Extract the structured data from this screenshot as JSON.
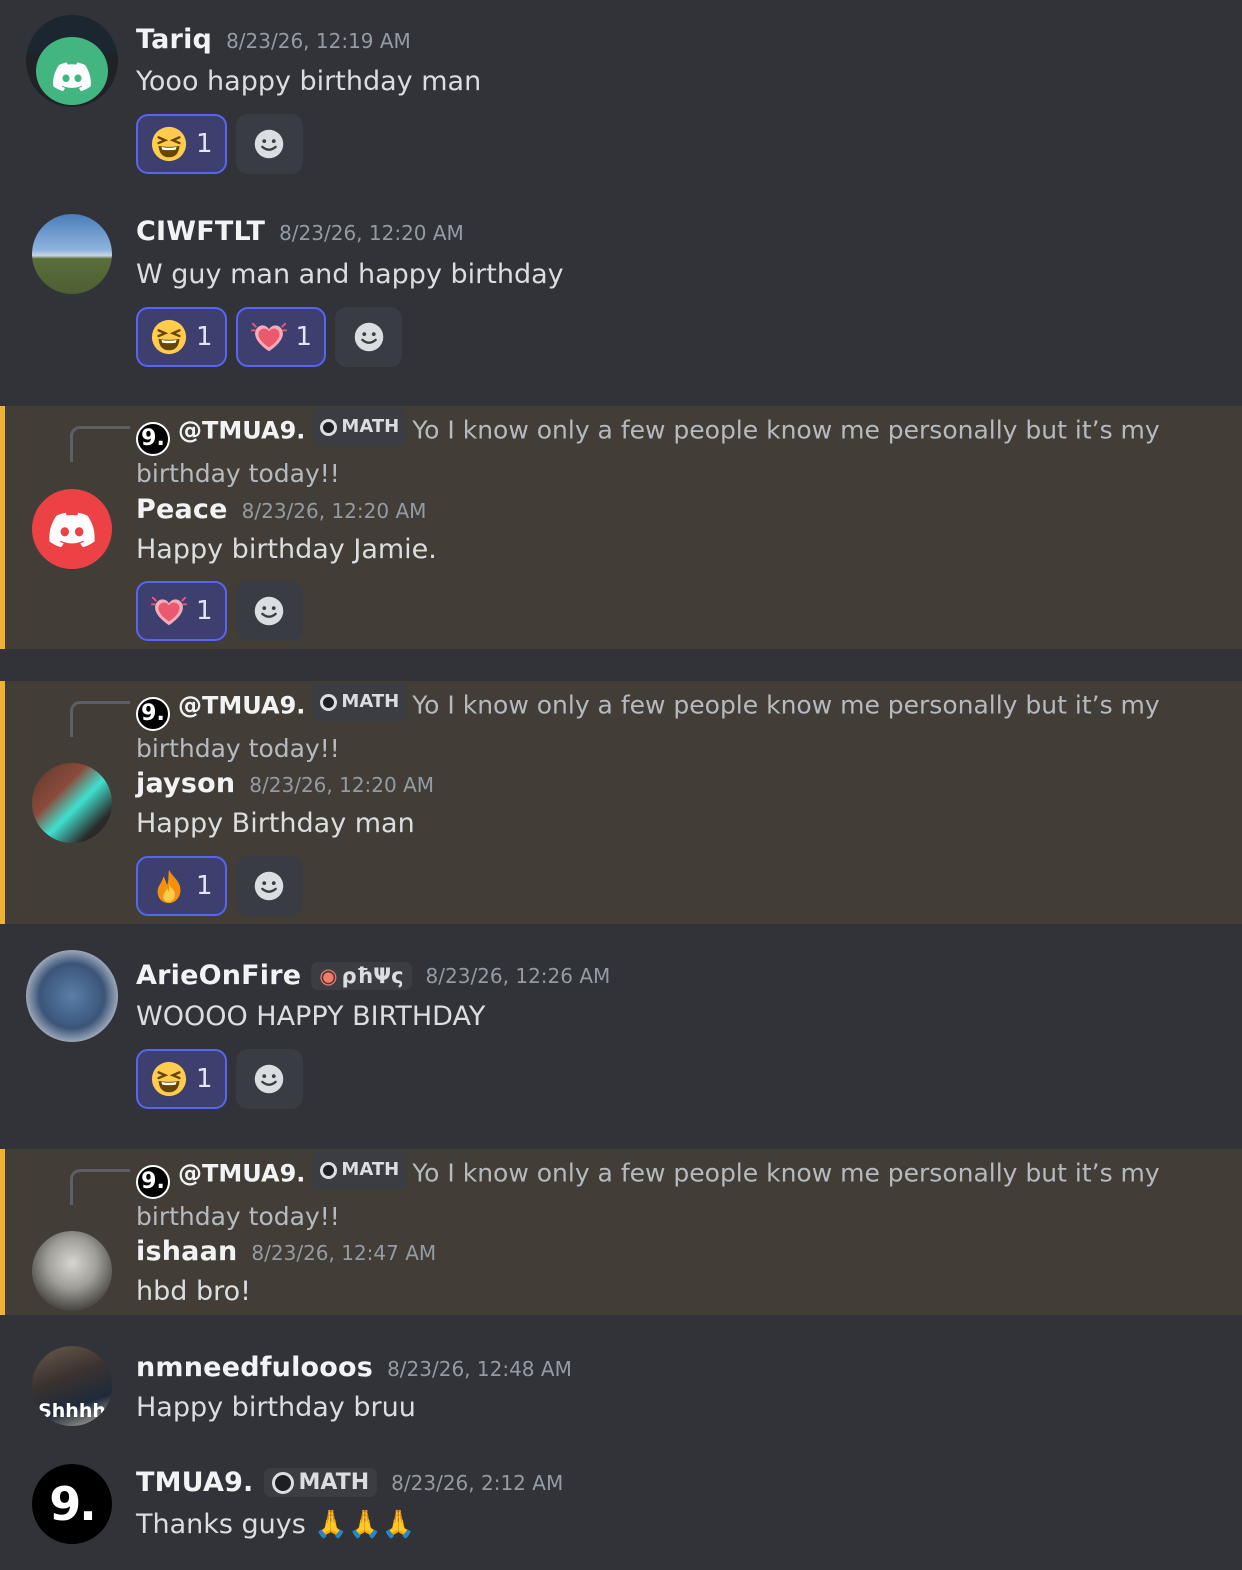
{
  "messages": [
    {
      "username": "Tariq",
      "timestamp": "8/23/26, 12:19 AM",
      "text": "Yooo happy birthday man",
      "reactions": [
        {
          "emoji": "laughing",
          "count": "1"
        }
      ]
    },
    {
      "username": "CIWFTLT",
      "timestamp": "8/23/26, 12:20 AM",
      "text": "W guy man and happy birthday",
      "reactions": [
        {
          "emoji": "laughing",
          "count": "1"
        },
        {
          "emoji": "heartpulse",
          "count": "1"
        }
      ]
    },
    {
      "reply": {
        "avatar_text": "9.",
        "mention": "@TMUA9.",
        "tag": "MATH",
        "text": "Yo I know only a few people know me personally but it’s my birthday today!!"
      },
      "username": "Peace",
      "timestamp": "8/23/26, 12:20 AM",
      "text": "Happy birthday Jamie.",
      "reactions": [
        {
          "emoji": "heartpulse",
          "count": "1"
        }
      ]
    },
    {
      "reply": {
        "avatar_text": "9.",
        "mention": "@TMUA9.",
        "tag": "MATH",
        "text": "Yo I know only a few people know me personally but it’s my birthday today!!"
      },
      "username": "jayson",
      "timestamp": "8/23/26, 12:20 AM",
      "text": "Happy Birthday man",
      "reactions": [
        {
          "emoji": "fire",
          "count": "1"
        }
      ]
    },
    {
      "username": "ArieOnFire",
      "tag": "ρħΨς",
      "timestamp": "8/23/26, 12:26 AM",
      "text": "WOOOO HAPPY BIRTHDAY",
      "reactions": [
        {
          "emoji": "laughing",
          "count": "1"
        }
      ]
    },
    {
      "reply": {
        "avatar_text": "9.",
        "mention": "@TMUA9.",
        "tag": "MATH",
        "text": "Yo I know only a few people know me personally but it’s my birthday today!!"
      },
      "username": "ishaan",
      "timestamp": "8/23/26, 12:47 AM",
      "text": "hbd bro!"
    },
    {
      "username": "nmneedfulooos",
      "avatar_text": "Shhhh",
      "timestamp": "8/23/26, 12:48 AM",
      "text": "Happy birthday bruu"
    },
    {
      "username": "TMUA9.",
      "avatar_text": "9.",
      "tag": "MATH",
      "timestamp": "8/23/26, 2:12 AM",
      "text": "Thanks guys 🙏🙏🙏"
    }
  ],
  "colors": {
    "background": "#313338",
    "highlight": "#423e37",
    "highlight_bar": "#f0b232",
    "reaction_me": "#3d3f6f",
    "reaction_border": "#5865f2"
  }
}
